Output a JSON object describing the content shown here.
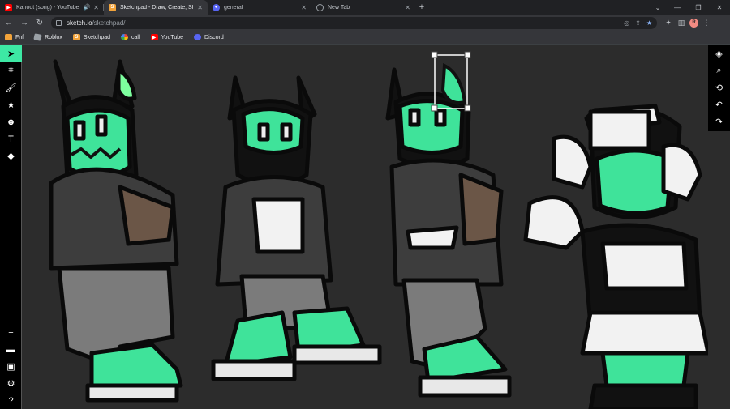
{
  "browser": {
    "tabs": [
      {
        "title": "Kahoot (song) - YouTube",
        "favicon": "youtube-icon",
        "color": "#ff0000",
        "audio": true,
        "active": false
      },
      {
        "title": "Sketchpad - Draw, Create, Share!",
        "favicon": "sketchpad-icon",
        "color": "#f2a33a",
        "audio": false,
        "active": true
      },
      {
        "title": "general",
        "favicon": "discord-icon",
        "color": "#5865f2",
        "audio": false,
        "active": false
      },
      {
        "title": "New Tab",
        "favicon": "chrome-icon",
        "color": "#9aa0a6",
        "audio": false,
        "active": false
      }
    ],
    "url_host": "sketch.io",
    "url_path": "/sketchpad/",
    "profile_initial": "R"
  },
  "bookmarks": [
    {
      "label": "Fnf",
      "icon": "folder-icon",
      "color": "#f2a33a"
    },
    {
      "label": "Roblox",
      "icon": "roblox-icon",
      "color": "#9aa0a6"
    },
    {
      "label": "Sketchpad",
      "icon": "sketchpad-icon",
      "color": "#f2a33a"
    },
    {
      "label": "call",
      "icon": "google-icon",
      "color": "#4285f4"
    },
    {
      "label": "YouTube",
      "icon": "youtube-icon",
      "color": "#ff0000"
    },
    {
      "label": "Discord",
      "icon": "discord-icon",
      "color": "#5865f2"
    }
  ],
  "colors": {
    "accent": "#3de8a4",
    "canvas_bg": "#2c2c2c",
    "character_green": "#3fe39a"
  }
}
